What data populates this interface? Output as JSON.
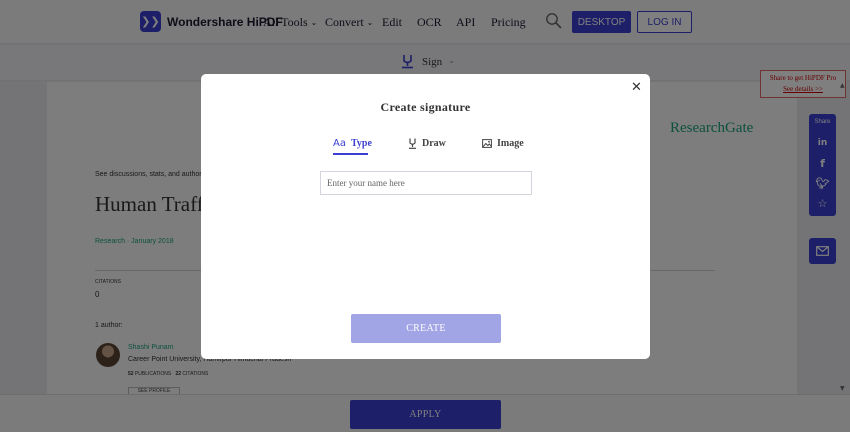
{
  "header": {
    "logo_text": "Wondershare HiPDF",
    "nav": {
      "all_tools": "All Tools",
      "convert": "Convert",
      "edit": "Edit",
      "ocr": "OCR",
      "api": "API",
      "pricing": "Pricing"
    },
    "desktop_button": "DESKTOP",
    "login_button": "LOG IN"
  },
  "toolbar": {
    "sign_label": "Sign"
  },
  "document": {
    "brand": "ResearchGate",
    "discussion_text": "See discussions, stats, and author p",
    "title": "Human Traffi",
    "meta": "Research · January 2018",
    "citations_label": "CITATIONS",
    "citations_value": "0",
    "authors_label": "1 author:",
    "author_name": "Shashi Punam",
    "author_affiliation": "Career Point University, Hamirpur Himachal Pradesh",
    "publications_count": "52",
    "publications_label": "PUBLICATIONS",
    "citations_count": "22",
    "citations_count_label": "CITATIONS",
    "see_profile": "SEE PROFILE"
  },
  "modal": {
    "title": "Create signature",
    "tabs": {
      "type": "Type",
      "draw": "Draw",
      "image": "Image"
    },
    "name_placeholder": "Enter your name here",
    "name_value": "",
    "create_button": "CREATE"
  },
  "side": {
    "share_label": "Share",
    "promo_text": "Share to get HiPDF Pro",
    "promo_link": "See details >>"
  },
  "bottom": {
    "apply_button": "APPLY"
  },
  "colors": {
    "accent": "#3b3fd1",
    "create_disabled": "#a1a5e6",
    "researchgate_green": "#19a17a",
    "promo_red": "#cc0000"
  }
}
